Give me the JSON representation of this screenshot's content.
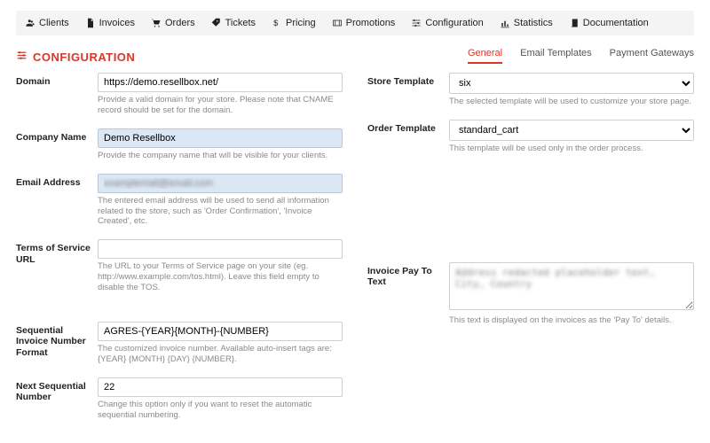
{
  "nav": {
    "clients": "Clients",
    "invoices": "Invoices",
    "orders": "Orders",
    "tickets": "Tickets",
    "pricing": "Pricing",
    "promotions": "Promotions",
    "configuration": "Configuration",
    "statistics": "Statistics",
    "documentation": "Documentation"
  },
  "page": {
    "title": "CONFIGURATION"
  },
  "subtabs": {
    "general": "General",
    "email_templates": "Email Templates",
    "payment_gateways": "Payment Gateways"
  },
  "fields": {
    "domain": {
      "label": "Domain",
      "value": "https://demo.resellbox.net/",
      "help": "Provide a valid domain for your store. Please note that CNAME record should be set for the domain."
    },
    "company": {
      "label": "Company Name",
      "value": "Demo Resellbox",
      "help": "Provide the company name that will be visible for your clients."
    },
    "email": {
      "label": "Email Address",
      "value": "examplemail@email.com",
      "help": "The entered email address will be used to send all information related to the store, such as 'Order Confirmation', 'Invoice Created', etc."
    },
    "tos": {
      "label": "Terms of Service URL",
      "value": "",
      "help": "The URL to your Terms of Service page on your site (eg. http://www.example.com/tos.html). Leave this field empty to disable the TOS."
    },
    "invoice_format": {
      "label": "Sequential Invoice Number Format",
      "value": "AGRES-{YEAR}{MONTH}-{NUMBER}",
      "help": "The customized invoice number. Available auto-insert tags are: {YEAR} {MONTH} {DAY} {NUMBER}."
    },
    "next_seq": {
      "label": "Next Sequential Number",
      "value": "22",
      "help": "Change this option only if you want to reset the automatic sequential numbering."
    },
    "store_template": {
      "label": "Store Template",
      "value": "six",
      "help": "The selected template will be used to customize your store page."
    },
    "order_template": {
      "label": "Order Template",
      "value": "standard_cart",
      "help": "This template will be used only in the order process."
    },
    "payto": {
      "label": "Invoice Pay To Text",
      "value": "Address redacted placeholder text, City, Country",
      "help": "This text is displayed on the invoices as the 'Pay To' details."
    }
  }
}
